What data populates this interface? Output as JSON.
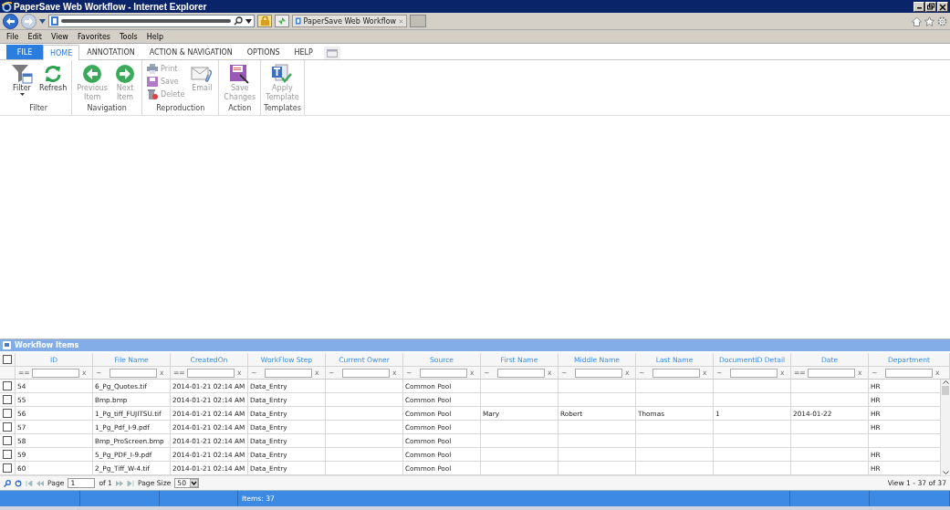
{
  "window": {
    "title": "PaperSave Web Workflow - Internet Explorer"
  },
  "browser": {
    "tab_title": "PaperSave Web Workflow"
  },
  "menu": [
    "File",
    "Edit",
    "View",
    "Favorites",
    "Tools",
    "Help"
  ],
  "ribbon": {
    "tabs": [
      {
        "label": "FILE",
        "kind": "file",
        "selected": false
      },
      {
        "label": "HOME",
        "kind": "tab",
        "selected": true
      },
      {
        "label": "ANNOTATION",
        "kind": "tab",
        "selected": false
      },
      {
        "label": "ACTION & NAVIGATION",
        "kind": "tab",
        "selected": false
      },
      {
        "label": "OPTIONS",
        "kind": "tab",
        "selected": false
      },
      {
        "label": "HELP",
        "kind": "tab",
        "selected": false
      }
    ],
    "groups": [
      {
        "label": "Filter",
        "buttons": [
          {
            "kind": "large",
            "label": "Filter",
            "dropdown": true,
            "disabled": false
          },
          {
            "kind": "large",
            "label": "Refresh",
            "disabled": false
          }
        ]
      },
      {
        "label": "Navigation",
        "buttons": [
          {
            "kind": "large",
            "label": "Previous\nItem",
            "disabled": true
          },
          {
            "kind": "large",
            "label": "Next\nItem",
            "disabled": true
          }
        ]
      },
      {
        "label": "Reproduction",
        "buttons": [
          {
            "kind": "small",
            "label": "Print",
            "disabled": true
          },
          {
            "kind": "small",
            "label": "Save",
            "disabled": true
          },
          {
            "kind": "small",
            "label": "Delete",
            "disabled": true
          },
          {
            "kind": "large",
            "label": "Email",
            "disabled": true
          }
        ]
      },
      {
        "label": "Action",
        "buttons": [
          {
            "kind": "large",
            "label": "Save\nChanges",
            "disabled": true
          }
        ]
      },
      {
        "label": "Templates",
        "buttons": [
          {
            "kind": "large",
            "label": "Apply\nTemplate",
            "disabled": true
          }
        ]
      }
    ]
  },
  "grid": {
    "title": "Workflow Items",
    "header_checked": false,
    "columns": [
      {
        "label": "ID",
        "operator": "==",
        "clear": "x"
      },
      {
        "label": "File Name",
        "operator": "~",
        "clear": "x"
      },
      {
        "label": "CreatedOn",
        "operator": "==",
        "clear": "x"
      },
      {
        "label": "WorkFlow Step",
        "operator": "~",
        "clear": "x"
      },
      {
        "label": "Current Owner",
        "operator": "~",
        "clear": "x"
      },
      {
        "label": "Source",
        "operator": "~",
        "clear": "x"
      },
      {
        "label": "First Name",
        "operator": "~",
        "clear": "x"
      },
      {
        "label": "Middle Name",
        "operator": "~",
        "clear": "x"
      },
      {
        "label": "Last Name",
        "operator": "~",
        "clear": "x"
      },
      {
        "label": "DocumentID Detail",
        "operator": "~",
        "clear": "x"
      },
      {
        "label": "Date",
        "operator": "==",
        "clear": "x"
      },
      {
        "label": "Department",
        "operator": "~",
        "clear": "x"
      }
    ],
    "rows": [
      {
        "checked": false,
        "cells": [
          "54",
          "6_Pg_Quotes.tif",
          "2014-01-21 02:14 AM",
          "Data_Entry",
          null,
          "Common Pool",
          null,
          null,
          null,
          null,
          null,
          "HR"
        ]
      },
      {
        "checked": false,
        "cells": [
          "55",
          "Bmp.bmp",
          "2014-01-21 02:14 AM",
          "Data_Entry",
          null,
          "Common Pool",
          null,
          null,
          null,
          null,
          null,
          "HR"
        ]
      },
      {
        "checked": false,
        "cells": [
          "56",
          "1_Pg_tiff_FUJITSU.tif",
          "2014-01-21 02:14 AM",
          "Data_Entry",
          null,
          "Common Pool",
          "Mary",
          "Robert",
          "Thomas",
          "1",
          "2014-01-22",
          "HR"
        ]
      },
      {
        "checked": false,
        "cells": [
          "57",
          "1_Pg_Pdf_I-9.pdf",
          "2014-01-21 02:14 AM",
          "Data_Entry",
          null,
          "Common Pool",
          null,
          null,
          null,
          null,
          null,
          "HR"
        ]
      },
      {
        "checked": false,
        "cells": [
          "58",
          "Bmp_ProScreen.bmp",
          "2014-01-21 02:14 AM",
          "Data_Entry",
          null,
          "Common Pool",
          null,
          null,
          null,
          null,
          null,
          null
        ]
      },
      {
        "checked": false,
        "cells": [
          "59",
          "5_Pg_PDF_I-9.pdf",
          "2014-01-21 02:14 AM",
          "Data_Entry",
          null,
          "Common Pool",
          null,
          null,
          null,
          null,
          null,
          "HR"
        ]
      },
      {
        "checked": false,
        "cells": [
          "60",
          "2_Pg_Tiff_W-4.tif",
          "2014-01-21 02:14 AM",
          "Data_Entry",
          null,
          "Common Pool",
          null,
          null,
          null,
          null,
          null,
          "HR"
        ]
      }
    ],
    "pager": {
      "page_label": "Page",
      "page": "1",
      "of": "of 1",
      "page_size_label": "Page Size",
      "page_size": "50",
      "view": "View 1 - 37 of 37"
    }
  },
  "status_bar": {
    "items": "Items: 37"
  }
}
